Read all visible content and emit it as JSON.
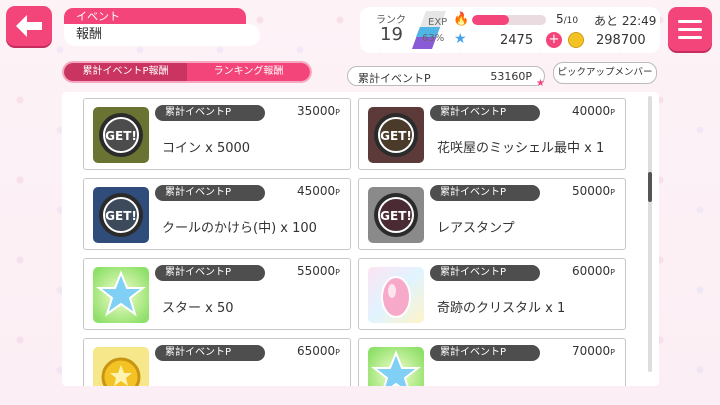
{
  "header": {
    "category": "イベント",
    "title": "報酬"
  },
  "status": {
    "rank_label": "ランク",
    "rank": "19",
    "exp_label": "EXP",
    "exp_percent": "63%",
    "life_current": "5",
    "life_max": "/10",
    "life_fraction": 0.5,
    "recover_label": "あと 22:49",
    "stars": "2475",
    "coins": "298700"
  },
  "tabs": [
    {
      "label": "累計イベントP報酬",
      "active": true
    },
    {
      "label": "ランキング報酬",
      "active": false
    }
  ],
  "points": {
    "label": "累計イベントP",
    "value": "53160P"
  },
  "pickup_button": "ピックアップメンバー",
  "rewards": [
    {
      "tag": "累計イベントP",
      "points": "35000",
      "unit": "P",
      "name": "コイン x 5000",
      "icon": "coin-get-icon"
    },
    {
      "tag": "累計イベントP",
      "points": "40000",
      "unit": "P",
      "name": "花咲屋のミッシェル最中 x 1",
      "icon": "item-get-icon"
    },
    {
      "tag": "累計イベントP",
      "points": "45000",
      "unit": "P",
      "name": "クールのかけら(中) x 100",
      "icon": "shard-get-icon"
    },
    {
      "tag": "累計イベントP",
      "points": "50000",
      "unit": "P",
      "name": "レアスタンプ",
      "icon": "stamp-get-icon"
    },
    {
      "tag": "累計イベントP",
      "points": "55000",
      "unit": "P",
      "name": "スター x 50",
      "icon": "star-icon"
    },
    {
      "tag": "累計イベントP",
      "points": "60000",
      "unit": "P",
      "name": "奇跡のクリスタル x 1",
      "icon": "crystal-icon"
    },
    {
      "tag": "累計イベントP",
      "points": "65000",
      "unit": "P",
      "name": "",
      "icon": "coin-icon"
    },
    {
      "tag": "累計イベントP",
      "points": "70000",
      "unit": "P",
      "name": "",
      "icon": "star-icon"
    }
  ]
}
